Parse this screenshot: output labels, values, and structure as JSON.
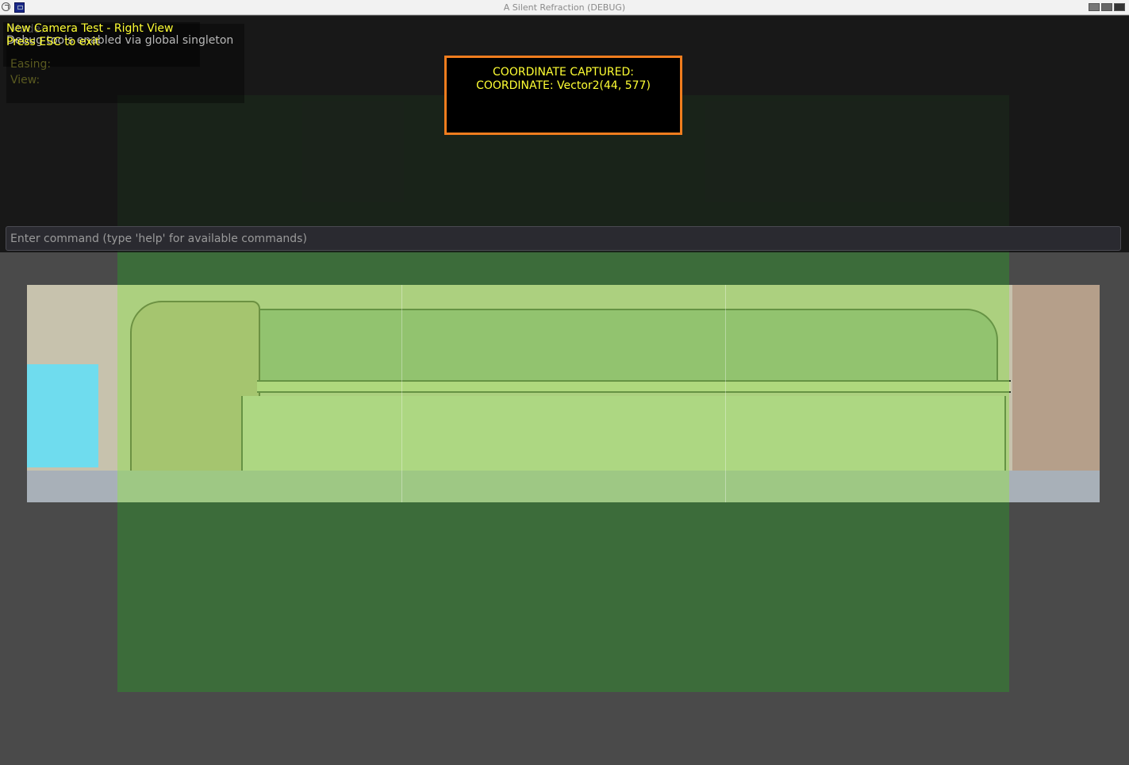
{
  "window": {
    "title": "A Silent Refraction (DEBUG)"
  },
  "overlay": {
    "camera_test_title": "New Camera Test - Right View",
    "exit_hint": "Press ESC to exit",
    "debug_status": "Debug tools enabled via global singleton",
    "faded_lines": {
      "line1": "Mode:",
      "easing": "Easing:",
      "view": "View:"
    }
  },
  "coordinate_box": {
    "line1": "COORDINATE CAPTURED:",
    "line2": "COORDINATE: Vector2(44, 577)"
  },
  "command_input": {
    "placeholder": "Enter command (type 'help' for available commands)",
    "value": ""
  },
  "colors": {
    "overlay_text": "#ffff33",
    "coordinate_box_border": "#f07d1e",
    "debug_rect": "#3c6c3a",
    "background": "#4a4a4a"
  }
}
